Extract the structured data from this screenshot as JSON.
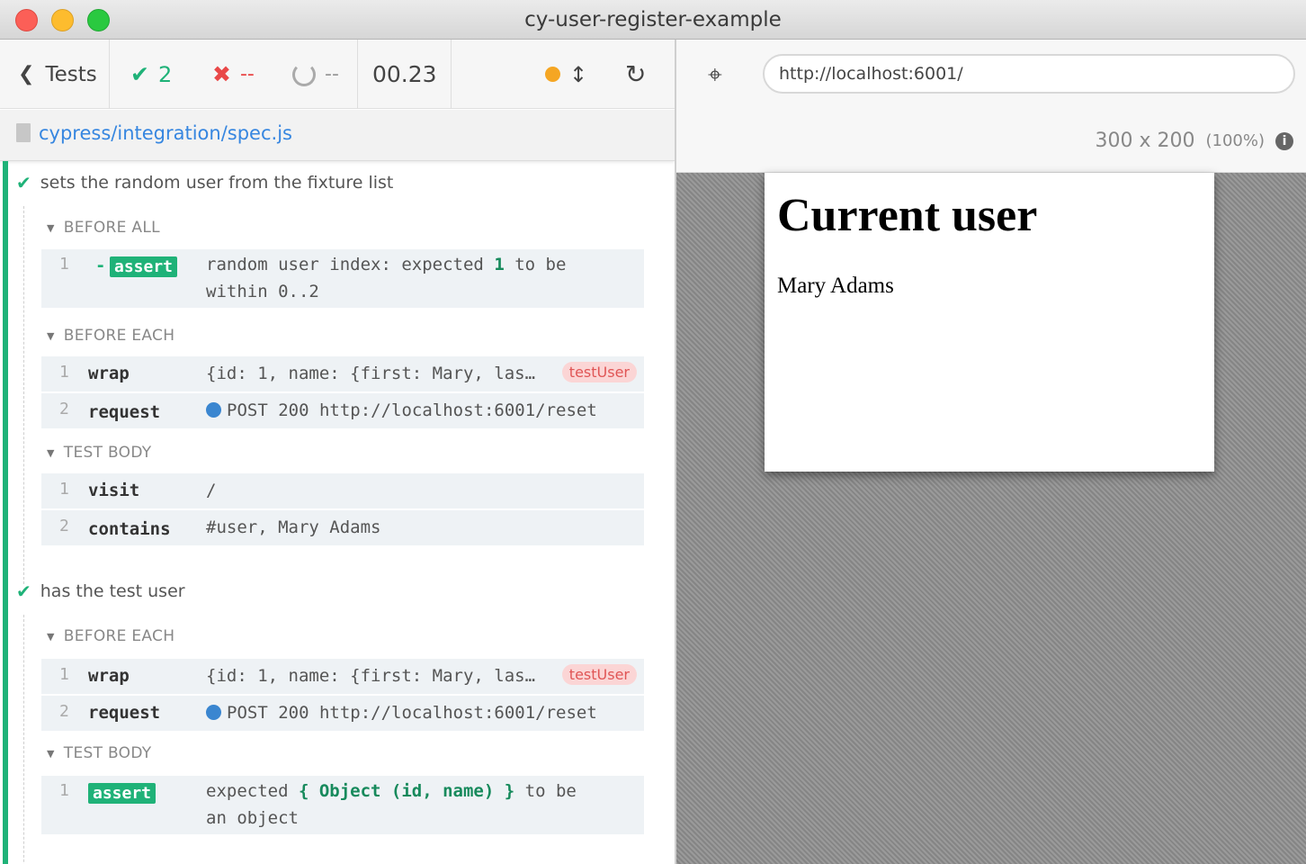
{
  "window": {
    "title": "cy-user-register-example"
  },
  "stats": {
    "tests_label": "Tests",
    "passed": "2",
    "failed": "--",
    "pending": "--",
    "duration": "00.23"
  },
  "spec": {
    "path": "cypress/integration/spec.js"
  },
  "tests": [
    {
      "title": "sets the random user from the fixture list",
      "hooks": [
        {
          "label": "BEFORE ALL",
          "commands": [
            {
              "n": "1",
              "prefix": "-",
              "badge": "assert",
              "msg_parts": [
                "random user index: expected",
                "1",
                "to be within 0..2"
              ]
            }
          ]
        },
        {
          "label": "BEFORE EACH",
          "commands": [
            {
              "n": "1",
              "name": "wrap",
              "msg": "{id: 1, name: {first: Mary, las…",
              "alias": "testUser"
            },
            {
              "n": "2",
              "name": "request",
              "msg": "POST 200 http://localhost:6001/reset"
            }
          ]
        },
        {
          "label": "TEST BODY",
          "commands": [
            {
              "n": "1",
              "name": "visit",
              "msg": "/"
            },
            {
              "n": "2",
              "name": "contains",
              "msg": "#user, Mary Adams"
            }
          ]
        }
      ]
    },
    {
      "title": "has the test user",
      "hooks": [
        {
          "label": "BEFORE EACH",
          "commands": [
            {
              "n": "1",
              "name": "wrap",
              "msg": "{id: 1, name: {first: Mary, las…",
              "alias": "testUser"
            },
            {
              "n": "2",
              "name": "request",
              "msg": "POST 200 http://localhost:6001/reset"
            }
          ]
        },
        {
          "label": "TEST BODY",
          "commands": [
            {
              "n": "1",
              "badge": "assert",
              "msg_parts": [
                "expected",
                "{ Object (id, name) }",
                "to be an object"
              ]
            }
          ]
        }
      ]
    }
  ],
  "aut": {
    "url": "http://localhost:6001/",
    "viewport": "300 x 200",
    "scale": "(100%)",
    "info": "i",
    "page_heading": "Current user",
    "page_user": "Mary Adams"
  },
  "icons": {
    "chevron": "chevron-left-icon",
    "pass": "check-icon",
    "fail": "x-icon",
    "pending": "spinner-icon",
    "indicator": "status-dot-icon",
    "scroll": "up-down-arrows-icon",
    "reload": "reload-icon",
    "file": "file-icon",
    "selector": "crosshair-icon"
  },
  "colors": {
    "pass": "#1fb278",
    "fail": "#e94848",
    "link": "#3686e0",
    "indicator": "#f5a623",
    "request_dot": "#3a86d0"
  }
}
